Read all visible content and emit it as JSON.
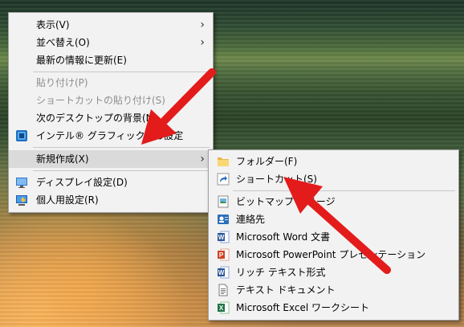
{
  "context_menu": {
    "items": [
      {
        "label": "表示(V)"
      },
      {
        "label": "並べ替え(O)"
      },
      {
        "label": "最新の情報に更新(E)"
      },
      {
        "label": "貼り付け(P)"
      },
      {
        "label": "ショートカットの貼り付け(S)"
      },
      {
        "label": "次のデスクトップの背景(N)"
      },
      {
        "label": "インテル® グラフィックスの設定"
      },
      {
        "label": "新規作成(X)"
      },
      {
        "label": "ディスプレイ設定(D)"
      },
      {
        "label": "個人用設定(R)"
      }
    ]
  },
  "submenu": {
    "items": [
      {
        "label": "フォルダー(F)"
      },
      {
        "label": "ショートカット(S)"
      },
      {
        "label": "ビットマップ イメージ"
      },
      {
        "label": "連絡先"
      },
      {
        "label": "Microsoft Word 文書"
      },
      {
        "label": "Microsoft PowerPoint プレゼンテーション"
      },
      {
        "label": "リッチ テキスト形式"
      },
      {
        "label": "テキスト ドキュメント"
      },
      {
        "label": "Microsoft Excel ワークシート"
      }
    ]
  },
  "colors": {
    "menu_bg": "#f2f2f2",
    "highlight": "#dadada",
    "disabled_text": "#8d8d8d",
    "annotation_arrow": "#e31b1b"
  }
}
